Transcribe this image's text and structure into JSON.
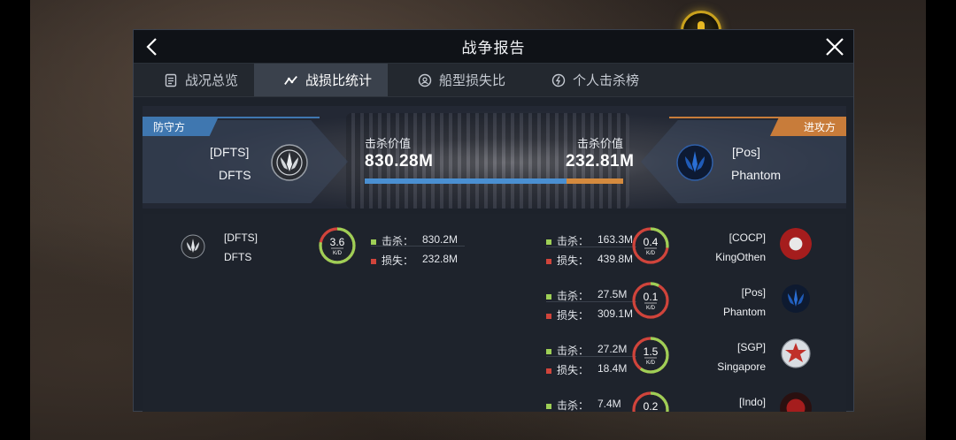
{
  "header": {
    "title": "战争报告"
  },
  "tabs": [
    {
      "label": "战况总览",
      "icon": "document-icon",
      "active": false
    },
    {
      "label": "战损比统计",
      "icon": "trend-icon",
      "active": true
    },
    {
      "label": "船型损失比",
      "icon": "ship-type-icon",
      "active": false
    },
    {
      "label": "个人击杀榜",
      "icon": "lightning-icon",
      "active": false
    }
  ],
  "summary": {
    "defender_label": "防守方",
    "attacker_label": "进攻方",
    "defender": {
      "tag": "[DFTS]",
      "name": "DFTS"
    },
    "attacker": {
      "tag": "[Pos]",
      "name": "Phantom"
    },
    "kill_value_label_def": "击杀价值",
    "kill_value_label_att": "击杀价值",
    "defender_kill_value": "830.28M",
    "attacker_kill_value": "232.81M",
    "defender_share": 0.781,
    "colors": {
      "defender": "#4a8fd1",
      "attacker": "#d48a3e"
    }
  },
  "kills_label": "击杀：",
  "losses_label": "损失：",
  "kd_unit": "K/D",
  "defender_rows": [
    {
      "tag": "[DFTS]",
      "name": "DFTS",
      "kills": "830.2M",
      "losses": "232.8M",
      "kd": "3.6",
      "kill_fraction": 0.78
    }
  ],
  "attacker_rows": [
    {
      "tag": "[COCP]",
      "name": "KingOthen",
      "kills": "163.3M",
      "losses": "439.8M",
      "kd": "0.4",
      "kill_fraction": 0.27
    },
    {
      "tag": "[Pos]",
      "name": "Phantom",
      "kills": "27.5M",
      "losses": "309.1M",
      "kd": "0.1",
      "kill_fraction": 0.08
    },
    {
      "tag": "[SGP]",
      "name": "Singapore",
      "kills": "27.2M",
      "losses": "18.4M",
      "kd": "1.5",
      "kill_fraction": 0.6
    },
    {
      "tag": "[Indo]",
      "name": "",
      "kills": "7.4M",
      "losses": "",
      "kd": "0.2",
      "kill_fraction": 0.5
    }
  ]
}
